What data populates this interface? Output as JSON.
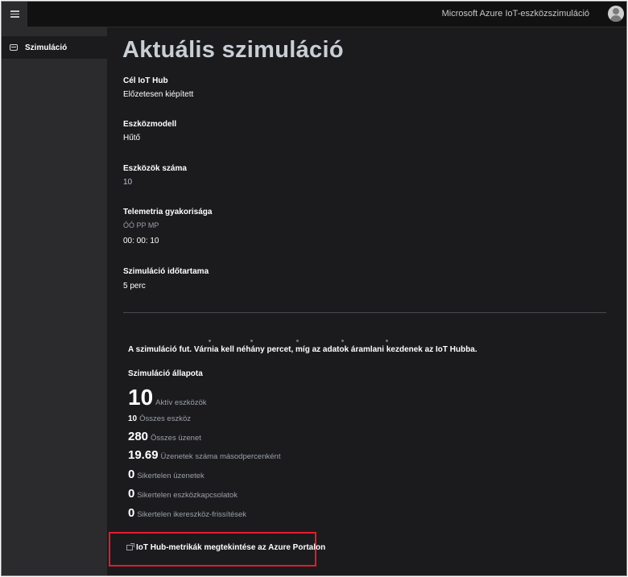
{
  "app": {
    "title": "Microsoft Azure IoT-eszközszimuláció"
  },
  "sidebar": {
    "items": [
      {
        "label": "Szimuláció"
      }
    ]
  },
  "page": {
    "title": "Aktuális szimuláció"
  },
  "fields": {
    "hub": {
      "label": "Cél IoT Hub",
      "value": "Előzetesen kiépített"
    },
    "model": {
      "label": "Eszközmodell",
      "value": "Hűtő"
    },
    "devices": {
      "label": "Eszközök száma",
      "value": "10"
    },
    "telemetry": {
      "label": "Telemetria gyakorisága",
      "hint": "ÓÓ PP MP",
      "value": "00: 00: 10"
    },
    "duration": {
      "label": "Szimuláció időtartama",
      "value": "5 perc"
    }
  },
  "status": {
    "running_message": "A szimuláció fut. Várnia kell néhány percet, míg az adatok áramlani kezdenek az IoT Hubba.",
    "title": "Szimuláció állapota",
    "stats": [
      {
        "value": "10",
        "label": "Aktív eszközök"
      },
      {
        "value": "10",
        "label": "Összes eszköz"
      },
      {
        "value": "280",
        "label": "Összes üzenet"
      },
      {
        "value": "19.69",
        "label": "Üzenetek száma másodpercenként"
      },
      {
        "value": "0",
        "label": "Sikertelen üzenetek"
      },
      {
        "value": "0",
        "label": "Sikertelen eszközkapcsolatok"
      },
      {
        "value": "0",
        "label": "Sikertelen ikereszköz-frissítések"
      }
    ]
  },
  "links": {
    "portal": "IoT Hub-metrikák megtekintése az Azure Portalon"
  },
  "icons": {
    "menu": "hamburger-menu-icon",
    "avatar": "user-avatar-icon",
    "sidebar_simulation": "simulation-icon",
    "external": "external-link-icon"
  },
  "colors": {
    "background": "#1b1b1e",
    "sidebar": "#2b2b2e",
    "highlight": "#e8192c",
    "title": "#c9ced6"
  }
}
